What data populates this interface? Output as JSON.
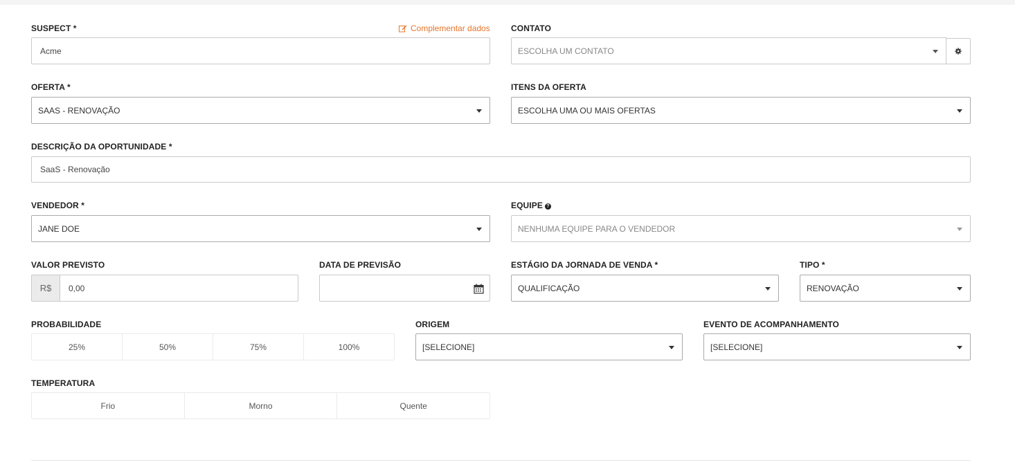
{
  "colors": {
    "accent": "#e8742a",
    "border": "#c9c9c9",
    "addon_bg": "#ebebeb"
  },
  "suspect": {
    "label": "SUSPECT *",
    "value": "Acme",
    "link_label": "Complementar dados",
    "link_icon": "edit-icon"
  },
  "contato": {
    "label": "CONTATO",
    "placeholder": "ESCOLHA UM CONTATO",
    "settings_icon": "gear-icon"
  },
  "oferta": {
    "label": "OFERTA *",
    "value": "SAAS - RENOVAÇÃO"
  },
  "itens_oferta": {
    "label": "ITENS DA OFERTA",
    "value": "ESCOLHA UMA OU MAIS OFERTAS"
  },
  "descricao": {
    "label": "DESCRIÇÃO DA OPORTUNIDADE *",
    "value": "SaaS - Renovação"
  },
  "vendedor": {
    "label": "VENDEDOR *",
    "value": "JANE DOE"
  },
  "equipe": {
    "label": "EQUIPE",
    "info_icon": "info-icon",
    "placeholder": "NENHUMA EQUIPE PARA O VENDEDOR"
  },
  "valor_previsto": {
    "label": "VALOR PREVISTO",
    "currency": "R$",
    "value": "0,00"
  },
  "data_previsao": {
    "label": "DATA DE PREVISÃO",
    "value": "",
    "icon": "calendar-icon"
  },
  "estagio": {
    "label": "ESTÁGIO DA JORNADA DE VENDA *",
    "value": "QUALIFICAÇÃO"
  },
  "tipo": {
    "label": "TIPO *",
    "value": "RENOVAÇÃO"
  },
  "probabilidade": {
    "label": "PROBABILIDADE",
    "options": [
      "25%",
      "50%",
      "75%",
      "100%"
    ]
  },
  "origem": {
    "label": "ORIGEM",
    "value": "[SELECIONE]"
  },
  "evento": {
    "label": "EVENTO DE ACOMPANHAMENTO",
    "value": "[SELECIONE]"
  },
  "temperatura": {
    "label": "TEMPERATURA",
    "options": [
      "Frio",
      "Morno",
      "Quente"
    ]
  }
}
